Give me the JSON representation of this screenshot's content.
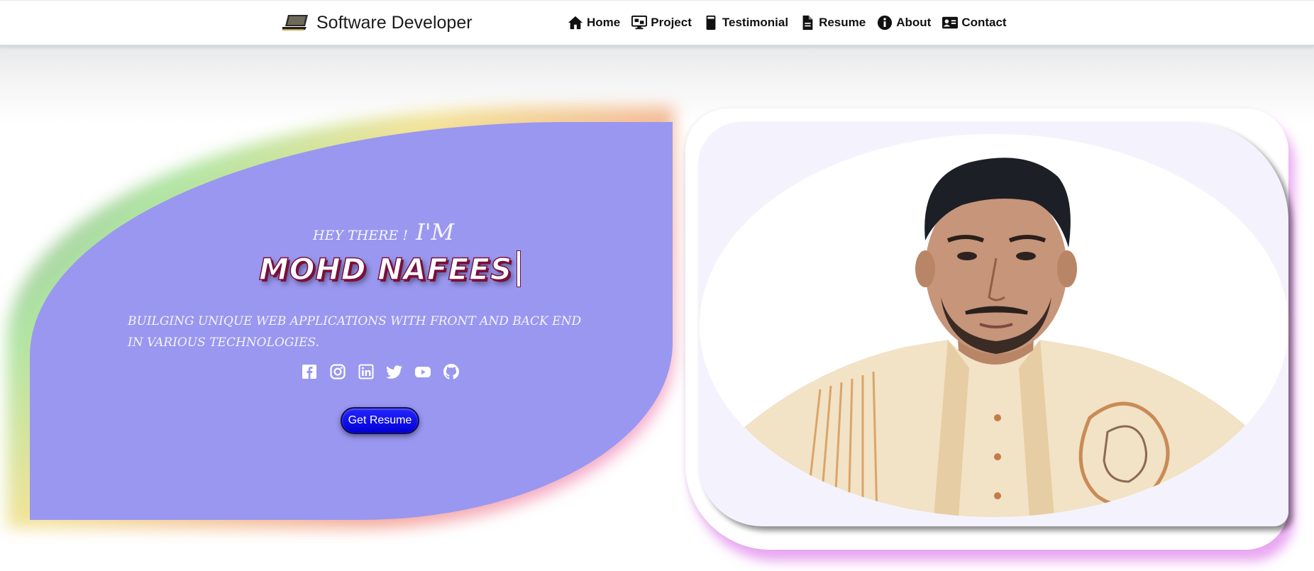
{
  "brand": {
    "title": "Software Developer",
    "icon": "laptop-icon"
  },
  "nav": {
    "items": [
      {
        "label": "Home",
        "icon": "home-icon"
      },
      {
        "label": "Project",
        "icon": "desktop-icon"
      },
      {
        "label": "Testimonial",
        "icon": "mobile-icon"
      },
      {
        "label": "Resume",
        "icon": "file-icon"
      },
      {
        "label": "About",
        "icon": "info-icon"
      },
      {
        "label": "Contact",
        "icon": "contact-card-icon"
      }
    ]
  },
  "hero": {
    "greeting_small": "HEY THERE !",
    "greeting_large": "I'M",
    "name": "MOHD NAFEES",
    "tagline": "BUILGING UNIQUE WEB APPLICATIONS WITH FRONT AND BACK END IN VARIOUS TECHNOLOGIES.",
    "button_label": "Get Resume",
    "social": [
      "facebook-icon",
      "instagram-icon",
      "linkedin-icon",
      "twitter-icon",
      "youtube-icon",
      "github-icon"
    ]
  },
  "colors": {
    "card_bg": "#9a97f0",
    "button_bg": "#0000d6",
    "name_shadow": "#7a0f3c",
    "photo_card_bg": "#f4f3fd"
  }
}
